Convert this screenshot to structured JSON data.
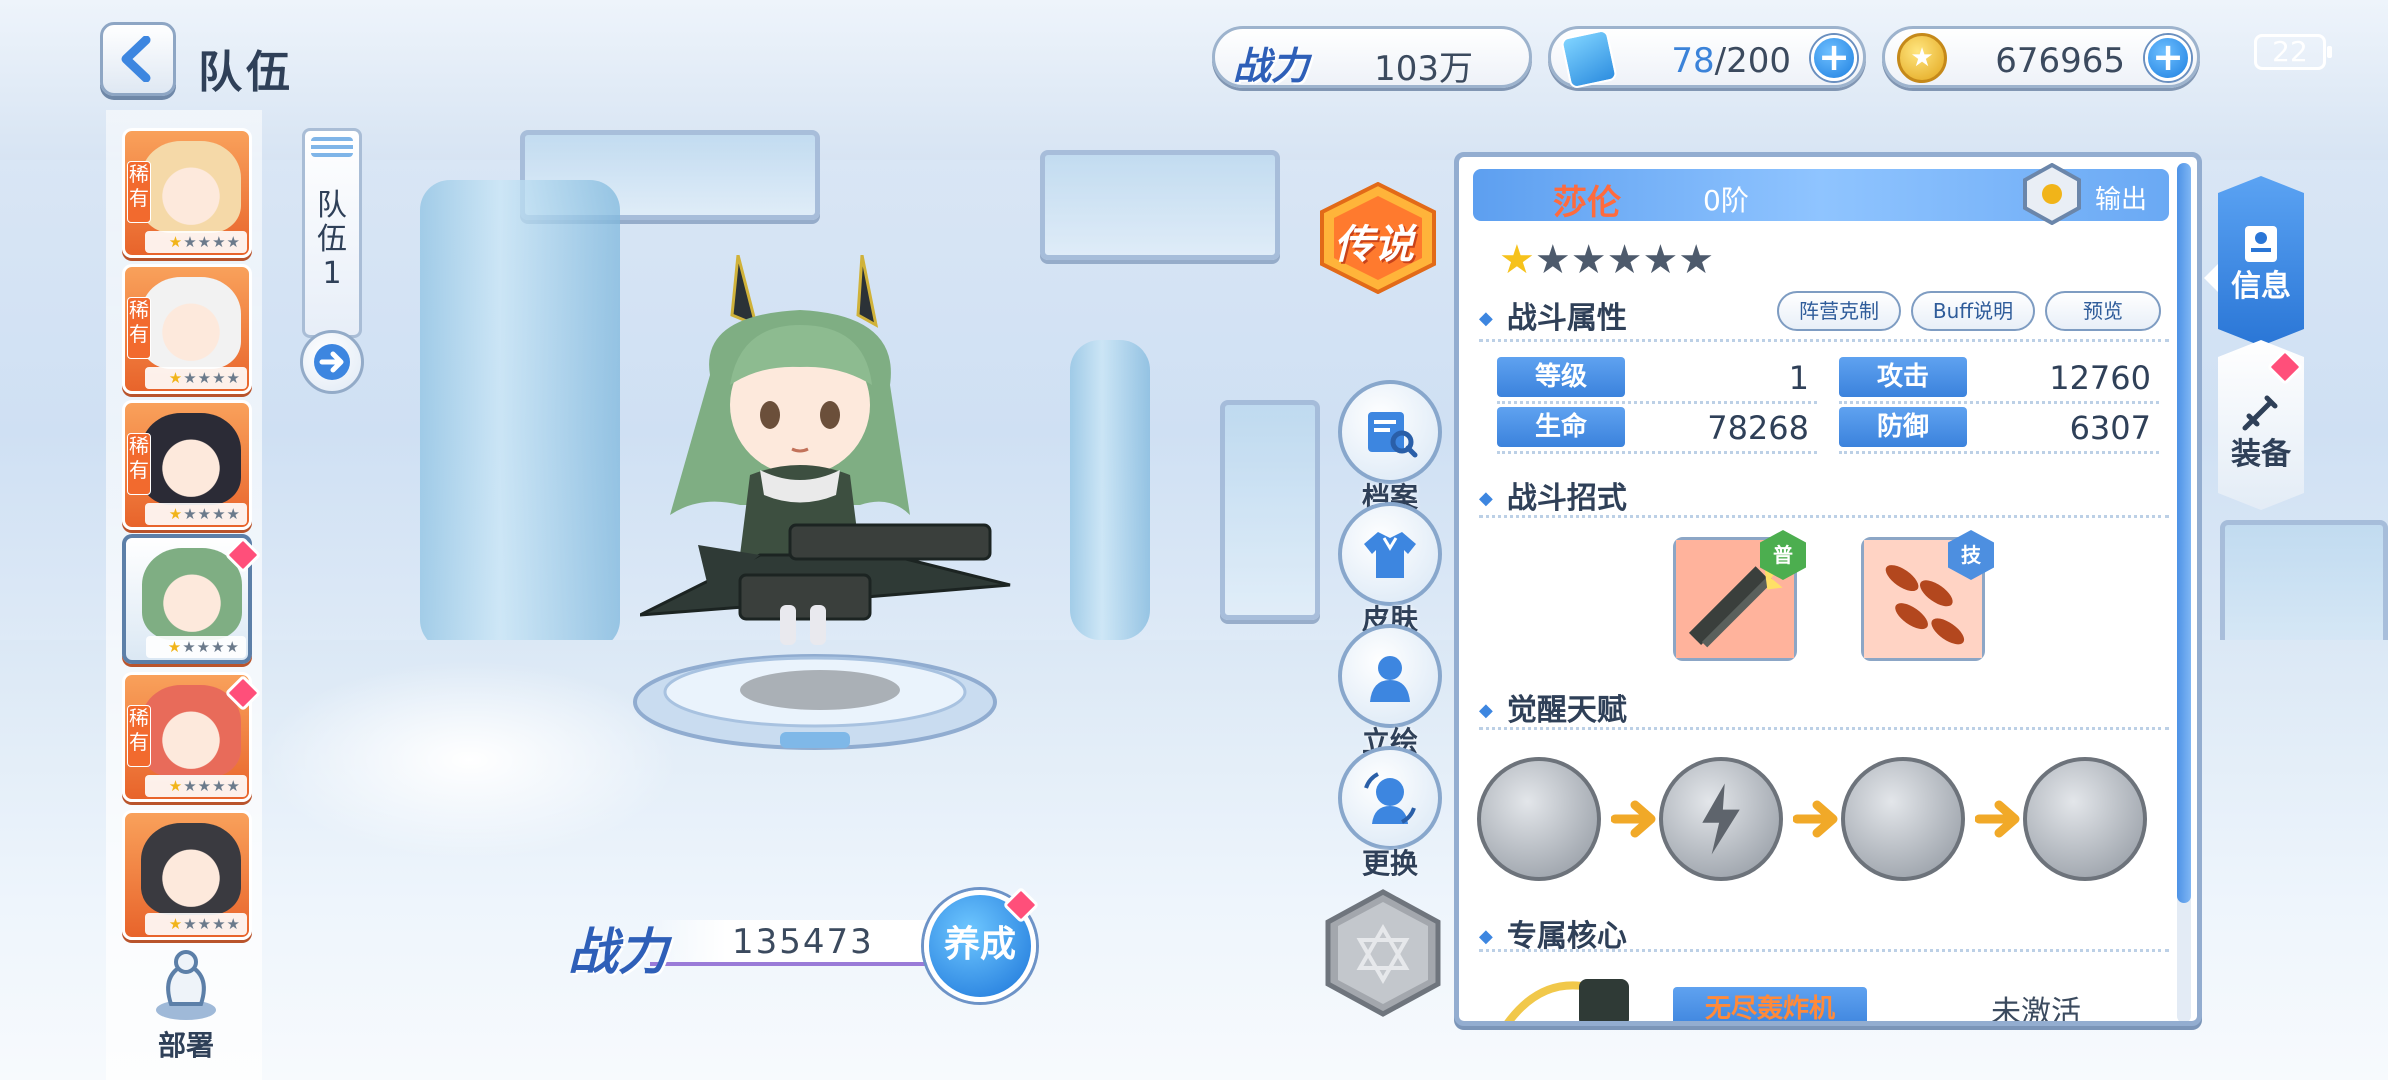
{
  "header": {
    "back_icon": "chevron-left-icon",
    "title": "队伍"
  },
  "resources": {
    "power": {
      "label": "战力",
      "value": "103万"
    },
    "stamina": {
      "current": "78",
      "max": "/200",
      "icon": "stamina-potion-icon"
    },
    "gold": {
      "value": "676965",
      "icon": "gold-coin-icon"
    },
    "battery": "22"
  },
  "team": {
    "tab_label": "队伍1",
    "tab_label_chars": [
      "队",
      "伍",
      "1"
    ],
    "arrow_icon": "arrow-right-icon",
    "members": [
      {
        "rarity": "稀有",
        "stars_gold": 1,
        "stars_total": 5,
        "selected": false,
        "badge": false,
        "hair": "#f5d9a8"
      },
      {
        "rarity": "稀有",
        "stars_gold": 1,
        "stars_total": 5,
        "selected": false,
        "badge": false,
        "hair": "#f2f2f2"
      },
      {
        "rarity": "稀有",
        "stars_gold": 1,
        "stars_total": 5,
        "selected": false,
        "badge": false,
        "hair": "#2b2b36"
      },
      {
        "rarity": "",
        "stars_gold": 1,
        "stars_total": 5,
        "selected": true,
        "badge": true,
        "hair": "#7fae83"
      },
      {
        "rarity": "稀有",
        "stars_gold": 1,
        "stars_total": 5,
        "selected": false,
        "badge": true,
        "hair": "#e86b5a"
      },
      {
        "rarity": "",
        "stars_gold": 1,
        "stars_total": 5,
        "selected": false,
        "badge": false,
        "hair": "#3a3a40"
      }
    ],
    "deploy_label": "部署"
  },
  "showcase": {
    "power_label": "战力",
    "power_value": "135473",
    "cultivate_label": "养成",
    "legend_badge": "传说"
  },
  "side_actions": [
    {
      "label": "档案",
      "icon": "profile-search-icon"
    },
    {
      "label": "皮肤",
      "icon": "outfit-icon"
    },
    {
      "label": "立绘",
      "icon": "portrait-icon"
    },
    {
      "label": "更换",
      "icon": "swap-character-icon"
    }
  ],
  "info_panel": {
    "name": "莎伦",
    "rank": "0阶",
    "role": "输出",
    "stars_gold": 1,
    "stars_total": 6,
    "combat_attr_title": "战斗属性",
    "buttons": [
      "阵营克制",
      "Buff说明",
      "预览"
    ],
    "stats": [
      {
        "label": "等级",
        "value": "1"
      },
      {
        "label": "攻击",
        "value": "12760"
      },
      {
        "label": "生命",
        "value": "78268"
      },
      {
        "label": "防御",
        "value": "6307"
      }
    ],
    "skills_title": "战斗招式",
    "skills": [
      {
        "tag": "普",
        "icon": "gatling-attack-icon",
        "tag_color": "#4cae4f"
      },
      {
        "tag": "技",
        "icon": "missile-barrage-icon",
        "tag_color": "#4d8fe0"
      }
    ],
    "talent_title": "觉醒天赋",
    "talents": [
      "drill-talent-icon",
      "lightning-talent-icon",
      "drill-talent-icon",
      "drill-talent-icon"
    ],
    "core_title": "专属核心",
    "core_name": "无尽轰炸机",
    "core_status": "未激活"
  },
  "right_tabs": [
    {
      "label": "信息",
      "icon": "id-card-icon"
    },
    {
      "label": "装备",
      "icon": "sword-icon"
    }
  ],
  "colors": {
    "accent_blue": "#3b82dc",
    "card_orange": "#e8642b",
    "red_badge": "#ff4f7a",
    "name_orange": "#ff6b3d"
  }
}
